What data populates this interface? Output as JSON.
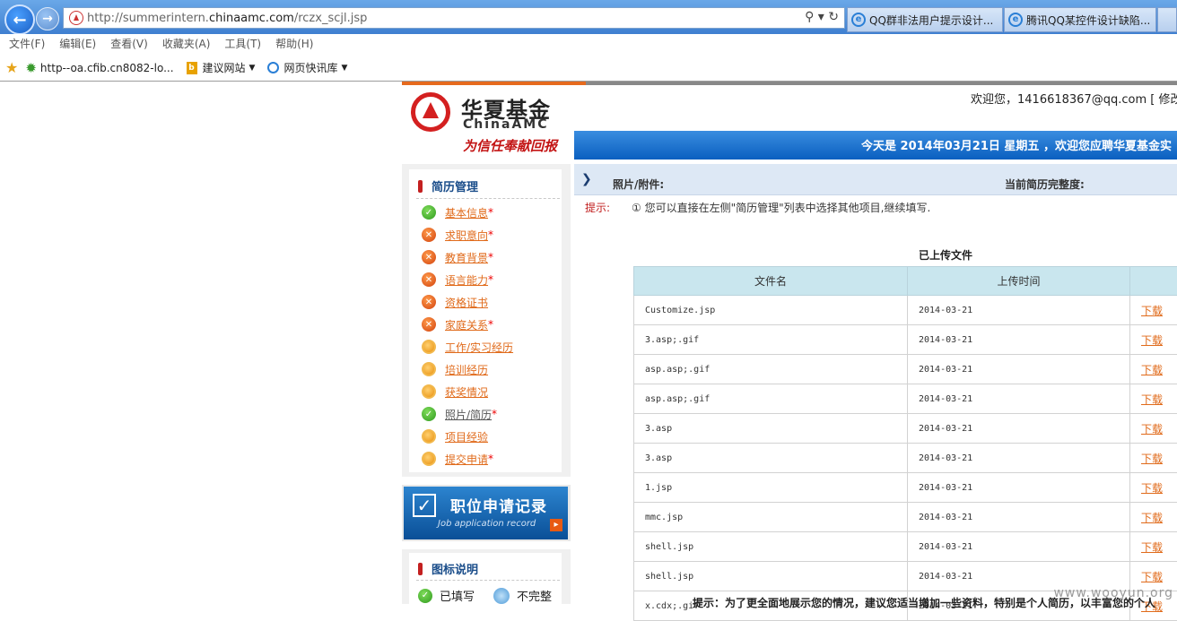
{
  "browser": {
    "url_prefix": "http://summerintern.",
    "url_domain": "chinaamc.com",
    "url_path": "/rczx_scjl.jsp",
    "tabs": [
      {
        "label": "QQ群非法用户提示设计..."
      },
      {
        "label": "腾讯QQ某控件设计缺陷..."
      }
    ],
    "menu": [
      "文件(F)",
      "编辑(E)",
      "查看(V)",
      "收藏夹(A)",
      "工具(T)",
      "帮助(H)"
    ],
    "favorites": [
      {
        "label": "http--oa.cfib.cn8082-lo..."
      },
      {
        "label": "建议网站"
      },
      {
        "label": "网页快讯库"
      }
    ]
  },
  "header": {
    "logo_cn": "华夏基金",
    "logo_en": "ChinaAMC",
    "logo_slogan": "为信任奉献回报",
    "welcome": "欢迎您，1416618367@qq.com [ 修改",
    "banner": "今天是 2014年03月21日 星期五 ，欢迎您应聘华夏基金实"
  },
  "sidebar": {
    "title": "简历管理",
    "items": [
      {
        "label": "基本信息",
        "required": "*",
        "status": "done"
      },
      {
        "label": "求职意向",
        "required": "*",
        "status": "error"
      },
      {
        "label": "教育背景",
        "required": "*",
        "status": "error"
      },
      {
        "label": "语言能力",
        "required": "*",
        "status": "error"
      },
      {
        "label": "资格证书",
        "required": "",
        "status": "error"
      },
      {
        "label": "家庭关系",
        "required": "*",
        "status": "error"
      },
      {
        "label": "工作/实习经历",
        "required": "",
        "status": "partial"
      },
      {
        "label": "培训经历",
        "required": "",
        "status": "partial"
      },
      {
        "label": "获奖情况",
        "required": "",
        "status": "partial"
      },
      {
        "label": "照片/简历",
        "required": "*",
        "status": "done"
      },
      {
        "label": "项目经验",
        "required": "",
        "status": "partial"
      },
      {
        "label": "提交申请",
        "required": "*",
        "status": "partial"
      }
    ]
  },
  "job_record": {
    "title_cn": "职位申请记录",
    "title_en": "Job application record"
  },
  "legend": {
    "title": "图标说明",
    "filled": "已填写",
    "incomplete": "不完整"
  },
  "section": {
    "title": "照片/附件:",
    "completeness_label": "当前简历完整度:"
  },
  "tip": {
    "label": "提示:",
    "text": "①  您可以直接在左侧\"简历管理\"列表中选择其他项目,继续填写."
  },
  "files": {
    "title": "已上传文件",
    "col_name": "文件名",
    "col_time": "上传时间",
    "rows": [
      {
        "name": "Customize.jsp",
        "time": "2014-03-21",
        "action": "下载"
      },
      {
        "name": "3.asp;.gif",
        "time": "2014-03-21",
        "action": "下载"
      },
      {
        "name": "asp.asp;.gif",
        "time": "2014-03-21",
        "action": "下载"
      },
      {
        "name": "asp.asp;.gif",
        "time": "2014-03-21",
        "action": "下载"
      },
      {
        "name": "3.asp",
        "time": "2014-03-21",
        "action": "下载"
      },
      {
        "name": "3.asp",
        "time": "2014-03-21",
        "action": "下载"
      },
      {
        "name": "1.jsp",
        "time": "2014-03-21",
        "action": "下载"
      },
      {
        "name": "mmc.jsp",
        "time": "2014-03-21",
        "action": "下载"
      },
      {
        "name": "shell.jsp",
        "time": "2014-03-21",
        "action": "下载"
      },
      {
        "name": "shell.jsp",
        "time": "2014-03-21",
        "action": "下载"
      },
      {
        "name": "x.cdx;.gif",
        "time": "2014-03-21",
        "action": "下载"
      }
    ]
  },
  "bottom_tip": "提示：为了更全面地展示您的情况，建议您适当增加一些资料，特别是个人简历，以丰富您的个人",
  "watermark": "www.wooyun.org"
}
